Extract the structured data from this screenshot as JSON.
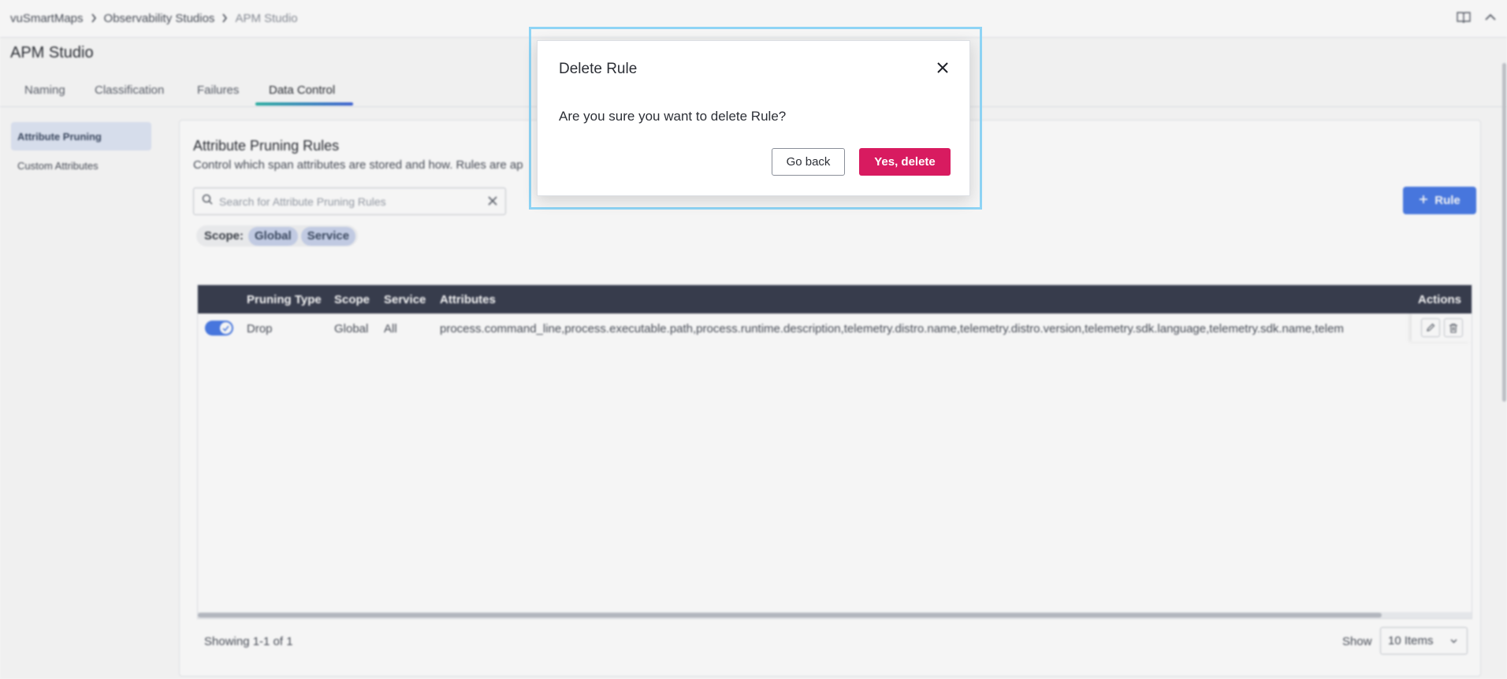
{
  "breadcrumb": {
    "items": [
      "vuSmartMaps",
      "Observability Studios",
      "APM Studio"
    ]
  },
  "page": {
    "title": "APM Studio"
  },
  "tabs": [
    {
      "label": "Naming"
    },
    {
      "label": "Classification"
    },
    {
      "label": "Failures"
    },
    {
      "label": "Data Control"
    }
  ],
  "active_tab": "Data Control",
  "subnav": {
    "items": [
      {
        "label": "Attribute Pruning"
      },
      {
        "label": "Custom Attributes"
      }
    ],
    "active": "Attribute Pruning"
  },
  "section": {
    "title": "Attribute Pruning Rules",
    "description": "Control which span attributes are stored and how. Rules are ap"
  },
  "search": {
    "placeholder": "Search for Attribute Pruning Rules",
    "value": ""
  },
  "add_rule": {
    "label": "Rule"
  },
  "scope_filter": {
    "label": "Scope:",
    "chips": [
      "Global",
      "Service"
    ]
  },
  "table": {
    "columns": [
      "Pruning Type",
      "Scope",
      "Service",
      "Attributes",
      "Actions"
    ],
    "rows": [
      {
        "enabled": true,
        "pruning_type": "Drop",
        "scope": "Global",
        "service": "All",
        "attributes": "process.command_line,process.executable.path,process.runtime.description,telemetry.distro.name,telemetry.distro.version,telemetry.sdk.language,telemetry.sdk.name,telem"
      }
    ]
  },
  "pagination": {
    "showing": "Showing 1-1 of 1",
    "show_label": "Show",
    "page_size": "10 Items"
  },
  "modal": {
    "title": "Delete Rule",
    "message": "Are you sure you want to delete Rule?",
    "cancel_label": "Go back",
    "confirm_label": "Yes, delete"
  },
  "colors": {
    "primary": "#4a7be6",
    "danger": "#d81b60",
    "table_header": "#3a3f50",
    "focus_ring": "#8ed4f5"
  },
  "icons": [
    "chevron-right-icon",
    "book-icon",
    "chevron-up-icon",
    "search-icon",
    "clear-icon",
    "plus-icon",
    "check-icon",
    "edit-icon",
    "trash-icon",
    "chevron-down-icon",
    "close-icon"
  ]
}
